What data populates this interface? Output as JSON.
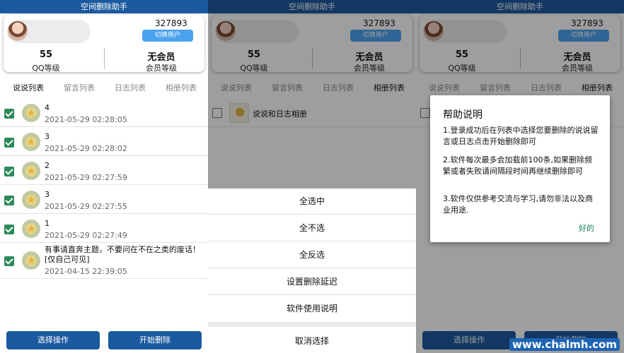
{
  "app": {
    "title": "空间删除助手"
  },
  "profile": {
    "qq": "327893",
    "switch_label": "切换用户",
    "qq_level_value": "55",
    "qq_level_label": "QQ等级",
    "member_value": "无会员",
    "member_label": "会员等级"
  },
  "tabs": [
    "说说列表",
    "留言列表",
    "日志列表",
    "相册列表"
  ],
  "list_rows": [
    {
      "title": "4",
      "date": "2021-05-29 02:28:05"
    },
    {
      "title": "3",
      "date": "2021-05-29 02:28:02"
    },
    {
      "title": "2",
      "date": "2021-05-29 02:27:59"
    },
    {
      "title": "3",
      "date": "2021-05-29 02:27:55"
    },
    {
      "title": "1",
      "date": "2021-05-29 02:27:49"
    },
    {
      "title": "有事请直奔主题，不要问在不在之类的废话！[仅自己可见]",
      "date": "2021-04-15 22:39:05"
    }
  ],
  "buttons": {
    "select_ops": "选择操作",
    "start_delete": "开始删除"
  },
  "album_row": {
    "title": "说说和日志相册"
  },
  "action_sheet": {
    "items": [
      "全选中",
      "全不选",
      "全反选",
      "设置删除延迟",
      "软件使用说明"
    ],
    "cancel": "取消选择"
  },
  "help_dialog": {
    "title": "帮助说明",
    "paragraphs": [
      "1.登录成功后在列表中选择您要删除的说说留言或日志点击开始删除即可",
      "2.软件每次最多会加载前100条,如果删除频繁或者失败请间隔段时间再继续删除即可",
      "3.软件仅供参考交流与学习,请勿非法以及商业用途."
    ],
    "ok": "好的"
  },
  "watermark": "www.chalmh.com",
  "colors": {
    "primary": "#1c5a9f",
    "accent_blue": "#4ba3f0",
    "checkbox": "#2b8a57",
    "ok_text": "#1a7d5a"
  }
}
